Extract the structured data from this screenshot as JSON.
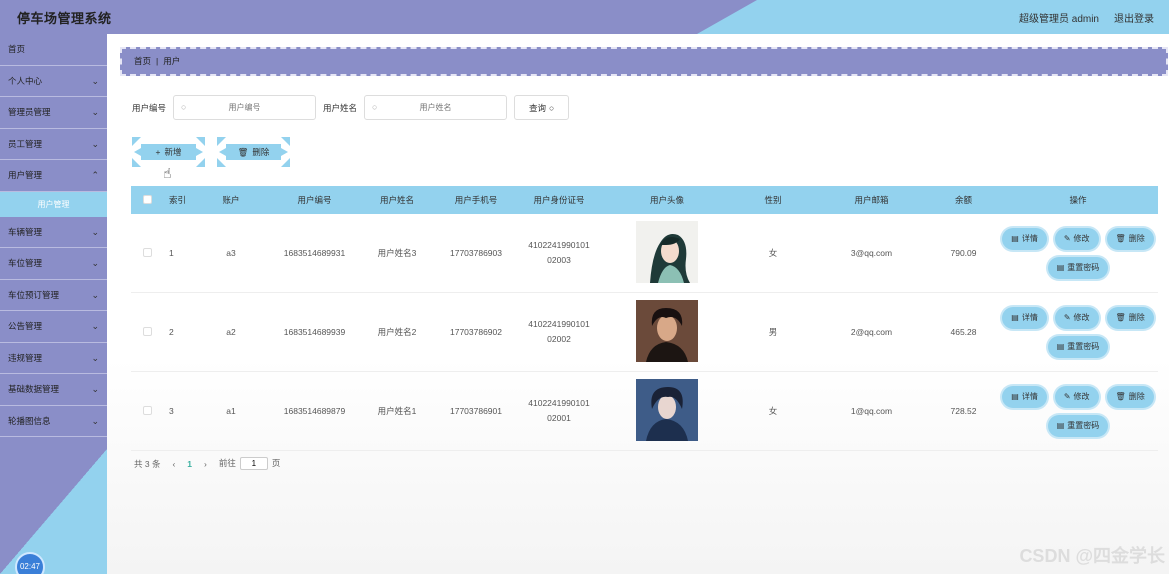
{
  "header": {
    "title": "停车场管理系统",
    "user": "超级管理员 admin",
    "logout": "退出登录"
  },
  "sidebar": {
    "items": [
      {
        "label": "首页",
        "chev": false
      },
      {
        "label": "个人中心",
        "chev": true
      },
      {
        "label": "管理员管理",
        "chev": true
      },
      {
        "label": "员工管理",
        "chev": true
      },
      {
        "label": "用户管理",
        "chev": true
      }
    ],
    "sub_item": "用户管理",
    "items2": [
      {
        "label": "车辆管理"
      },
      {
        "label": "车位管理"
      },
      {
        "label": "车位预订管理"
      },
      {
        "label": "公告管理"
      },
      {
        "label": "违规管理"
      },
      {
        "label": "基础数据管理"
      },
      {
        "label": "轮播图信息"
      }
    ],
    "clock": "02:47"
  },
  "breadcrumb": {
    "home": "首页",
    "sep": "|",
    "current": "用户"
  },
  "search": {
    "label1": "用户编号",
    "placeholder1": "用户编号",
    "label2": "用户姓名",
    "placeholder2": "用户姓名",
    "query": "查询"
  },
  "actions": {
    "add": "新增",
    "delete": "删除"
  },
  "table": {
    "headers": [
      "索引",
      "账户",
      "用户编号",
      "用户姓名",
      "用户手机号",
      "用户身份证号",
      "用户头像",
      "性别",
      "用户邮箱",
      "余额",
      "操作"
    ],
    "rows": [
      {
        "index": "1",
        "account": "a3",
        "id": "1683514689931",
        "name": "用户姓名3",
        "phone": "17703786903",
        "idcard1": "4102241990101",
        "idcard2": "02003",
        "gender": "女",
        "email": "3@qq.com",
        "balance": "790.09"
      },
      {
        "index": "2",
        "account": "a2",
        "id": "1683514689939",
        "name": "用户姓名2",
        "phone": "17703786902",
        "idcard1": "4102241990101",
        "idcard2": "02002",
        "gender": "男",
        "email": "2@qq.com",
        "balance": "465.28"
      },
      {
        "index": "3",
        "account": "a1",
        "id": "1683514689879",
        "name": "用户姓名1",
        "phone": "17703786901",
        "idcard1": "4102241990101",
        "idcard2": "02001",
        "gender": "女",
        "email": "1@qq.com",
        "balance": "728.52"
      }
    ],
    "ops": {
      "detail": "详情",
      "edit": "修改",
      "delete": "删除",
      "reset": "重置密码"
    }
  },
  "pager": {
    "total": "共 3 条",
    "page": "1",
    "goto_prefix": "前往",
    "goto_value": "1",
    "goto_suffix": "页"
  },
  "watermark": "CSDN @四金学长",
  "colors": {
    "purple": "#8a8ec8",
    "blue": "#93d2ee"
  }
}
